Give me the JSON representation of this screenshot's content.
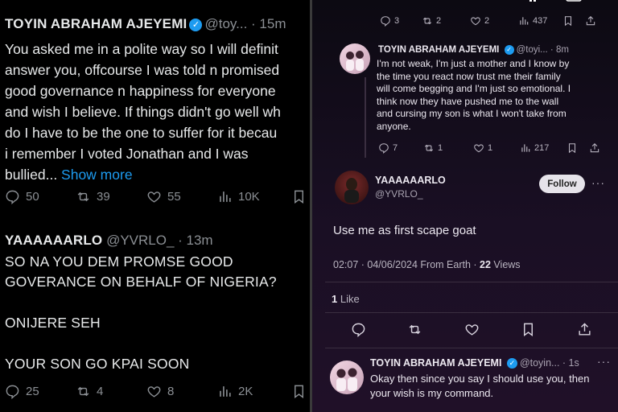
{
  "left": {
    "tweet1": {
      "name": "TOYIN ABRAHAM AJEYEMI",
      "handle_time": "@toy... · 15m",
      "lines": [
        "You asked me in a polite way so I will definit",
        "answer you, offcourse I was told n promised",
        "good governance n happiness for everyone",
        "and wish I believe. If things didn't go well wh",
        "do I have to be the one to suffer for it becau",
        "i remember I voted Jonathan and I was"
      ],
      "last_line": "bullied... ",
      "show_more": "Show more",
      "stats": {
        "replies": "50",
        "reposts": "39",
        "likes": "55",
        "views": "10K"
      }
    },
    "tweet2": {
      "name": "YAAAAAARLO",
      "handle_time": "@YVRLO_ · 13m",
      "lines": [
        "SO NA YOU DEM PROMSE GOOD",
        "GOVERANCE ON BEHALF OF NIGERIA?"
      ],
      "line3": "ONIJERE SEH",
      "line4": "YOUR SON GO KPAI SOON",
      "stats": {
        "replies": "25",
        "reposts": "4",
        "likes": "8",
        "views": "2K"
      }
    }
  },
  "right": {
    "top_stats": {
      "replies": "3",
      "reposts": "2",
      "likes": "2",
      "views": "437"
    },
    "reply1": {
      "name": "TOYIN ABRAHAM AJEYEMI",
      "handle_time": "@toyi... · 8m",
      "lines": [
        "I'm not weak, I'm just a mother and I know by",
        "the time you react now trust me their family",
        "will come begging and I'm just so emotional. I",
        "think now they have pushed me to the wall",
        "and cursing my son is what I won't take from",
        "anyone."
      ],
      "stats": {
        "replies": "7",
        "reposts": "1",
        "likes": "1",
        "views": "217"
      }
    },
    "main": {
      "name": "YAAAAAARLO",
      "handle": "@YVRLO_",
      "follow": "Follow",
      "text": "Use me as first scape goat",
      "meta_time": "02:07 · 04/06/2024 From Earth · ",
      "views": "22",
      "views_label": " Views",
      "likes_count": "1",
      "likes_label": " Like"
    },
    "reply2": {
      "name": "TOYIN ABRAHAM AJEYEMI",
      "handle_time": "@toyin... · 1s",
      "lines": [
        "Okay then since you say I should use you, then",
        "your wish is my command."
      ]
    }
  },
  "colors": {
    "accent": "#1d9bf0",
    "dark_bg": "#000000",
    "purple_bg": "#1a0f24"
  }
}
